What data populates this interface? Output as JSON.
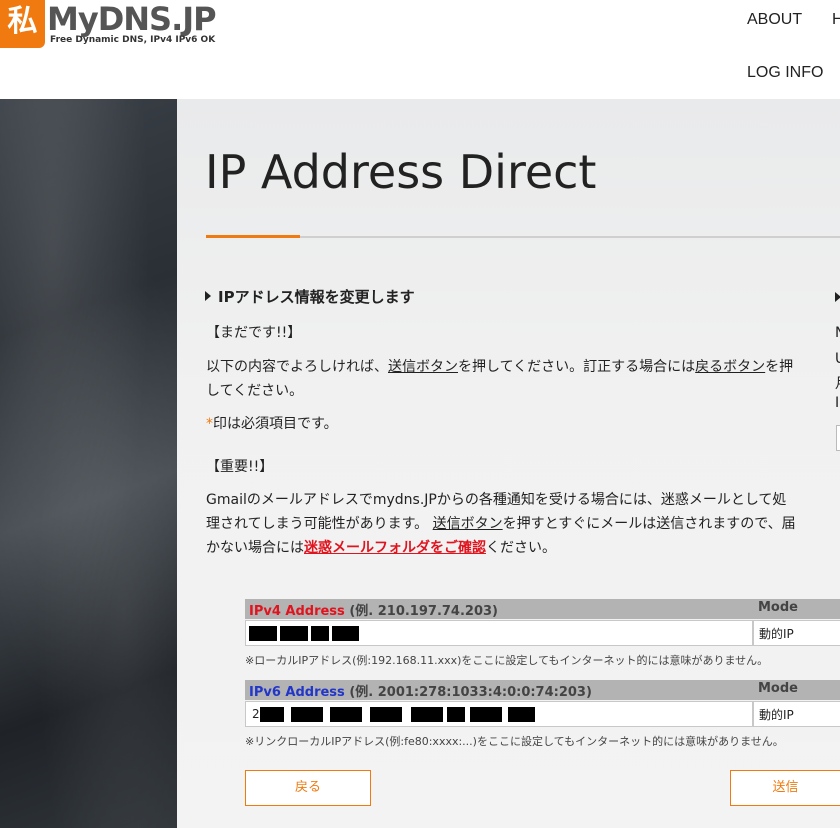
{
  "header": {
    "logo_mark": "私",
    "logo_text": "MyDNS.JP",
    "logo_sub": "Free Dynamic DNS, IPv4 IPv6 OK",
    "nav": {
      "about": "ABOUT",
      "h_clipped": "H",
      "log_info": "LOG INFO"
    }
  },
  "main": {
    "title": "IP Address Direct",
    "section_title": "IPアドレス情報を変更します",
    "status": "【まだです!!】",
    "confirm_line1_a": "以下の内容でよろしければ、",
    "confirm_send_link": "送信ボタン",
    "confirm_line1_b": "を押してください。訂正する場合には",
    "confirm_back_link": "戻るボタン",
    "confirm_line1_c": "を押",
    "confirm_line2": "してください。",
    "required_star": "*",
    "required_note": "印は必須項目です。",
    "important": "【重要!!】",
    "gmail_line1": "Gmailのメールアドレスでmydns.JPからの各種通知を受ける場合には、迷惑メールとして処",
    "gmail_line2_a": "理されてしまう可能性があります。 ",
    "gmail_send_link": "送信ボタン",
    "gmail_line2_b": "を押すとすぐにメールは送信されますので、届",
    "gmail_line3_a": "かない場合には",
    "gmail_spam_link": "迷惑メールフォルダをご確認",
    "gmail_line3_b": "ください。",
    "right_clipped": [
      "N",
      "U",
      "月",
      "I"
    ]
  },
  "ipv4": {
    "label": "IPv4 Address",
    "example": " (例. 210.197.74.203)",
    "mode_header": "Mode",
    "mode_value": "動的IP",
    "note": "※ローカルIPアドレス(例:192.168.11.xxx)をここに設定してもインターネット的には意味がありません。"
  },
  "ipv6": {
    "label": "IPv6 Address",
    "example": " (例. 2001:278:1033:4:0:0:74:203)",
    "mode_header": "Mode",
    "mode_value": "動的IP",
    "value_prefix": "2",
    "note": "※リンクローカルIPアドレス(例:fe80:xxxx:...)をここに設定してもインターネット的には意味がありません。"
  },
  "buttons": {
    "back": "戻る",
    "send": "送信"
  },
  "colors": {
    "accent": "#f07a10",
    "ipv4_label": "#e0141e",
    "ipv6_label": "#2236c8"
  }
}
